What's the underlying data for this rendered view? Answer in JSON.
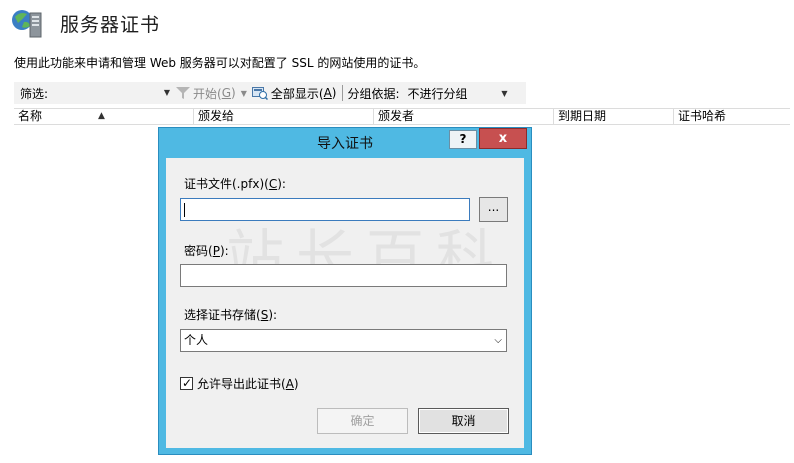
{
  "header": {
    "title": "服务器证书",
    "description": "使用此功能来申请和管理 Web 服务器可以对配置了 SSL 的网站使用的证书。"
  },
  "toolbar": {
    "filter_label": "筛选:",
    "start_label": "开始(",
    "start_key": "G",
    "start_tail": ")",
    "showall_label": "全部显示(",
    "showall_key": "A",
    "showall_tail": ")",
    "groupby_label": "分组依据:",
    "groupby_value": "不进行分组"
  },
  "list": {
    "columns": [
      "名称",
      "颁发给",
      "颁发者",
      "到期日期",
      "证书哈希"
    ]
  },
  "watermark": "站长百科",
  "dialog": {
    "title": "导入证书",
    "help_label": "?",
    "close_label": "x",
    "file_label": "证书文件(.pfx)(",
    "file_key": "C",
    "file_tail": "):",
    "file_value": "",
    "browse_label": "...",
    "password_label": "密码(",
    "password_key": "P",
    "password_tail": "):",
    "password_value": "",
    "store_label": "选择证书存储(",
    "store_key": "S",
    "store_tail": "):",
    "store_value": "个人",
    "export_label": "允许导出此证书(",
    "export_key": "A",
    "export_tail": ")",
    "export_checked": true,
    "ok_label": "确定",
    "cancel_label": "取消"
  },
  "colors": {
    "dialog_frame": "#4fb9e3",
    "close_button": "#c75050",
    "toolbar_bg": "#f2f2f2"
  }
}
